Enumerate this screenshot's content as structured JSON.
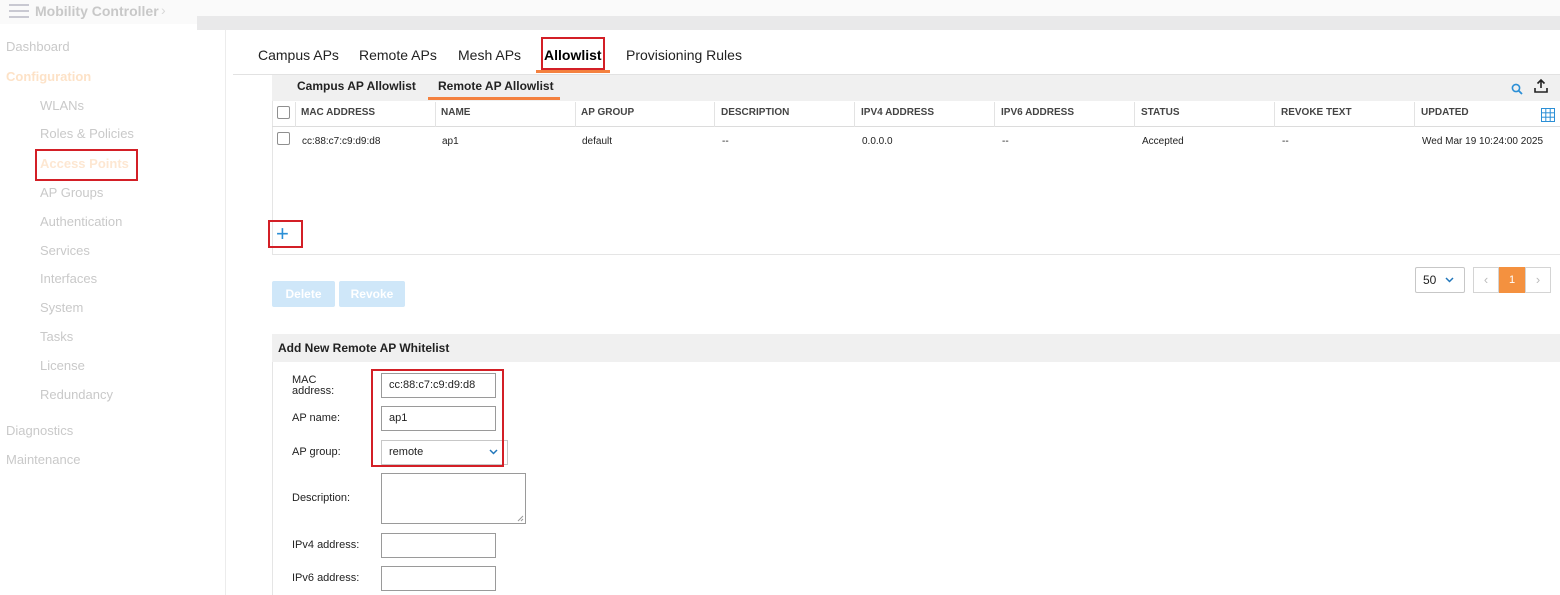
{
  "app": {
    "title": "Mobility Controller",
    "breadcrumb_chevron": "›"
  },
  "sidebar": {
    "dashboard": "Dashboard",
    "configuration": "Configuration",
    "items": [
      "WLANs",
      "Roles & Policies",
      "Access Points",
      "AP Groups",
      "Authentication",
      "Services",
      "Interfaces",
      "System",
      "Tasks",
      "License",
      "Redundancy"
    ],
    "diagnostics": "Diagnostics",
    "maintenance": "Maintenance"
  },
  "tabs": [
    "Campus APs",
    "Remote APs",
    "Mesh APs",
    "Allowlist",
    "Provisioning Rules"
  ],
  "subtabs": [
    "Campus AP Allowlist",
    "Remote AP Allowlist"
  ],
  "icons": {
    "search": "search-icon",
    "export": "upload-icon",
    "columns": "grid-icon",
    "add": "plus-icon"
  },
  "table": {
    "headers": [
      "MAC ADDRESS",
      "NAME",
      "AP GROUP",
      "DESCRIPTION",
      "IPV4 ADDRESS",
      "IPV6 ADDRESS",
      "STATUS",
      "REVOKE TEXT",
      "UPDATED"
    ],
    "rows": [
      [
        "cc:88:c7:c9:d9:d8",
        "ap1",
        "default",
        "--",
        "0.0.0.0",
        "--",
        "Accepted",
        "--",
        "Wed Mar 19 10:24:00 2025"
      ]
    ]
  },
  "actions": {
    "delete": "Delete",
    "revoke": "Revoke",
    "add_symbol": "+"
  },
  "pagination": {
    "page_size": "50",
    "prev": "‹",
    "current": "1",
    "next": "›"
  },
  "form": {
    "title": "Add New Remote AP Whitelist",
    "mac_label_line1": "MAC",
    "mac_label_line2": "address:",
    "mac_value": "cc:88:c7:c9:d9:d8",
    "name_label": "AP name:",
    "name_value": "ap1",
    "group_label": "AP group:",
    "group_value": "remote",
    "description_label": "Description:",
    "ipv4_label": "IPv4 address:",
    "ipv6_label": "IPv6 address:"
  },
  "colors": {
    "accent": "#f4813f",
    "link_blue": "#2b8fd6",
    "highlight_red": "#d31f26"
  }
}
